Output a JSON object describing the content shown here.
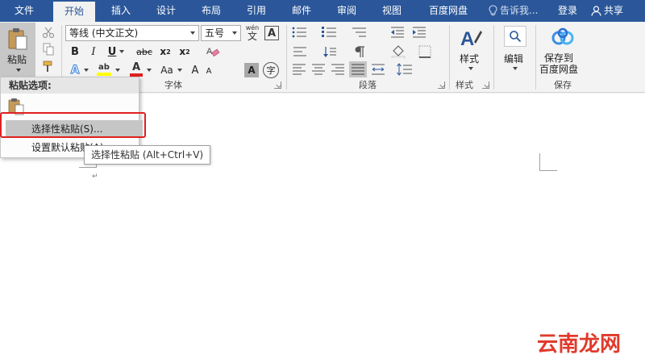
{
  "tabs": [
    {
      "label": "文件",
      "active": false
    },
    {
      "label": "开始",
      "active": true
    },
    {
      "label": "插入",
      "active": false
    },
    {
      "label": "设计",
      "active": false
    },
    {
      "label": "布局",
      "active": false
    },
    {
      "label": "引用",
      "active": false
    },
    {
      "label": "邮件",
      "active": false
    },
    {
      "label": "审阅",
      "active": false
    },
    {
      "label": "视图",
      "active": false
    },
    {
      "label": "百度网盘",
      "active": false
    }
  ],
  "tell_me": "告诉我...",
  "login": "登录",
  "share": "共享",
  "clipboard": {
    "paste_label": "粘贴"
  },
  "font": {
    "font_name": "等线 (中文正文)",
    "font_size": "五号",
    "wen_glyph": "wén",
    "wen_char": "文",
    "border_char": "A",
    "bold": "B",
    "italic": "I",
    "underline": "U",
    "strike": "abc",
    "sub": "x",
    "sub_mark": "2",
    "sup": "x",
    "sup_mark": "2",
    "text_effect": "A",
    "highlight_mark": "ab",
    "font_color": "A",
    "change_case": "Aa",
    "grow": "A",
    "shrink": "A",
    "shading": "A",
    "enclose": "字",
    "group_label": "字体"
  },
  "paragraph": {
    "group_label": "段落"
  },
  "styles": {
    "label": "样式",
    "group_label": "样式"
  },
  "editing": {
    "label": "编辑"
  },
  "save": {
    "label_line1": "保存到",
    "label_line2": "百度网盘",
    "group_label": "保存"
  },
  "paste_menu": {
    "header": "粘贴选项:",
    "item1": "选择性粘贴(S)...",
    "item2": "设置默认粘贴(A)..."
  },
  "tooltip": "选择性粘贴 (Alt+Ctrl+V)",
  "watermark": "云南龙网",
  "colors": {
    "tab_bar": "#2b579a",
    "ribbon": "#f3f3f3",
    "highlight_red": "#e02020",
    "font_color_red": "#e02020",
    "highlight_yellow": "#ffff00"
  }
}
